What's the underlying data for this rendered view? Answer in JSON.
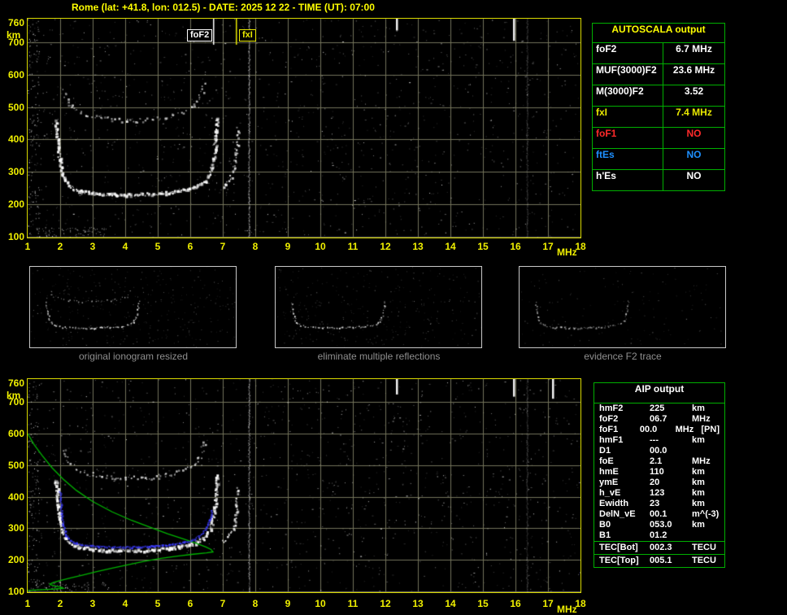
{
  "title": "Rome (lat: +41.8, lon: 012.5) - DATE: 2025 12 22 - TIME (UT): 07:00",
  "colors": {
    "accent_yellow": "#ffff00",
    "plot_border_yellow": "#d9d900",
    "grid_olive": "#73735a",
    "table_green": "#00b000",
    "trace_white": "#ffffff",
    "profile_green": "#00b400",
    "restored_blue": "#3c3cff",
    "caption_gray": "#8f8f8f"
  },
  "autoscala_table": {
    "header": "AUTOSCALA output",
    "rows": [
      {
        "label": "foF2",
        "value": "6.7 MHz",
        "color": "#ffffff"
      },
      {
        "label": "MUF(3000)F2",
        "value": "23.6 MHz",
        "color": "#ffffff"
      },
      {
        "label": "M(3000)F2",
        "value": "3.52",
        "color": "#ffffff"
      },
      {
        "label": "fxI",
        "value": "7.4 MHz",
        "color": "#e8e800"
      },
      {
        "label": "foF1",
        "value": "NO",
        "color": "#ff2a2a"
      },
      {
        "label": "ftEs",
        "value": "NO",
        "color": "#1e90ff"
      },
      {
        "label": "h'Es",
        "value": "NO",
        "color": "#ffffff"
      }
    ]
  },
  "thumbnails": [
    {
      "caption": "original ionogram resized"
    },
    {
      "caption": "eliminate multiple reflections"
    },
    {
      "caption": "evidence F2 trace"
    }
  ],
  "aip_table": {
    "header": "AIP output",
    "rows": [
      [
        "hmF2",
        "225",
        "km"
      ],
      [
        "foF2",
        "06.7",
        "MHz"
      ],
      [
        "foF1",
        "00.0",
        "MHz   [PN]"
      ],
      [
        "hmF1",
        "---",
        "km"
      ],
      [
        "D1",
        "00.0",
        ""
      ],
      [
        "foE",
        "2.1",
        "MHz"
      ],
      [
        "hmE",
        "110",
        "km"
      ],
      [
        "ymE",
        "20",
        "km"
      ],
      [
        "h_vE",
        "123",
        "km"
      ],
      [
        "Ewidth",
        "23",
        "km"
      ],
      [
        "DelN_vE",
        "00.1",
        "m^(-3)"
      ],
      [
        "B0",
        "053.0",
        "km"
      ],
      [
        "B1",
        "01.2",
        ""
      ],
      [
        "TEC[Bot]",
        "002.3",
        "TECU"
      ],
      [
        "TEC[Top]",
        "005.1",
        "TECU"
      ]
    ]
  },
  "chart_data": [
    {
      "type": "scatter",
      "name": "scaled ionogram (virtual height vs frequency)",
      "xlabel": "MHz",
      "ylabel": "km",
      "xlim": [
        1,
        18
      ],
      "ylim": [
        100,
        760
      ],
      "x_ticks": [
        1,
        2,
        3,
        4,
        5,
        6,
        7,
        8,
        9,
        10,
        11,
        12,
        13,
        14,
        15,
        16,
        17,
        18
      ],
      "y_ticks": [
        760,
        700,
        600,
        500,
        400,
        300,
        200,
        100
      ],
      "grid": true,
      "legend": false,
      "markers": [
        {
          "label": "foF2",
          "freq_mhz": 6.7,
          "color": "#ffffff"
        },
        {
          "label": "fxI",
          "freq_mhz": 7.4,
          "color": "#e8e800"
        }
      ],
      "rfi_lines_mhz": [
        7.8,
        16.35
      ],
      "top_ticks_mhz": [
        12.35,
        15.95
      ],
      "series": [
        {
          "name": "F2 trace 1st hop",
          "points": [
            [
              1.85,
              460
            ],
            [
              1.88,
              420
            ],
            [
              1.92,
              380
            ],
            [
              1.96,
              345
            ],
            [
              2.0,
              315
            ],
            [
              2.06,
              292
            ],
            [
              2.12,
              276
            ],
            [
              2.22,
              262
            ],
            [
              2.35,
              252
            ],
            [
              2.5,
              245
            ],
            [
              2.7,
              240
            ],
            [
              3.0,
              236
            ],
            [
              3.3,
              233
            ],
            [
              3.6,
              232
            ],
            [
              4.0,
              231
            ],
            [
              4.4,
              232
            ],
            [
              4.8,
              234
            ],
            [
              5.2,
              237
            ],
            [
              5.6,
              242
            ],
            [
              5.9,
              248
            ],
            [
              6.1,
              255
            ],
            [
              6.3,
              264
            ],
            [
              6.45,
              276
            ],
            [
              6.55,
              291
            ],
            [
              6.63,
              312
            ],
            [
              6.69,
              338
            ],
            [
              6.73,
              368
            ],
            [
              6.76,
              402
            ],
            [
              6.79,
              440
            ],
            [
              6.81,
              472
            ]
          ]
        },
        {
          "name": "X-mode cusp near fxI",
          "points": [
            [
              6.95,
              256
            ],
            [
              7.05,
              263
            ],
            [
              7.15,
              273
            ],
            [
              7.25,
              289
            ],
            [
              7.32,
              312
            ],
            [
              7.38,
              344
            ],
            [
              7.42,
              388
            ],
            [
              7.45,
              436
            ]
          ]
        },
        {
          "name": "F2 trace 2nd hop",
          "points": [
            [
              2.1,
              560
            ],
            [
              2.15,
              532
            ],
            [
              2.25,
              510
            ],
            [
              2.4,
              495
            ],
            [
              2.6,
              484
            ],
            [
              2.9,
              474
            ],
            [
              3.2,
              468
            ],
            [
              3.6,
              463
            ],
            [
              4.0,
              461
            ],
            [
              4.4,
              461
            ],
            [
              4.8,
              464
            ],
            [
              5.2,
              470
            ],
            [
              5.6,
              479
            ],
            [
              5.9,
              490
            ],
            [
              6.1,
              504
            ],
            [
              6.25,
              524
            ],
            [
              6.35,
              550
            ],
            [
              6.42,
              582
            ]
          ]
        }
      ]
    },
    {
      "type": "scatter",
      "name": "ionogram with autoscaled trace and electron density profile",
      "xlabel": "MHz",
      "ylabel": "km",
      "xlim": [
        1,
        18
      ],
      "ylim": [
        100,
        760
      ],
      "x_ticks": [
        1,
        2,
        3,
        4,
        5,
        6,
        7,
        8,
        9,
        10,
        11,
        12,
        13,
        14,
        15,
        16,
        17,
        18
      ],
      "y_ticks": [
        760,
        700,
        600,
        500,
        400,
        300,
        200,
        100
      ],
      "grid": true,
      "legend": false,
      "rfi_lines_mhz": [
        7.8,
        16.35
      ],
      "top_ticks_mhz": [
        12.35,
        15.95,
        17.15
      ],
      "series": [
        {
          "name": "F2 trace 1st hop",
          "points": [
            [
              1.85,
              460
            ],
            [
              1.88,
              420
            ],
            [
              1.92,
              380
            ],
            [
              1.96,
              345
            ],
            [
              2.0,
              315
            ],
            [
              2.06,
              292
            ],
            [
              2.12,
              276
            ],
            [
              2.22,
              262
            ],
            [
              2.35,
              252
            ],
            [
              2.5,
              245
            ],
            [
              2.7,
              240
            ],
            [
              3.0,
              236
            ],
            [
              3.3,
              233
            ],
            [
              3.6,
              232
            ],
            [
              4.0,
              231
            ],
            [
              4.4,
              232
            ],
            [
              4.8,
              234
            ],
            [
              5.2,
              237
            ],
            [
              5.6,
              242
            ],
            [
              5.9,
              248
            ],
            [
              6.1,
              255
            ],
            [
              6.3,
              264
            ],
            [
              6.45,
              276
            ],
            [
              6.55,
              291
            ],
            [
              6.63,
              312
            ],
            [
              6.69,
              338
            ],
            [
              6.73,
              368
            ],
            [
              6.76,
              402
            ],
            [
              6.79,
              440
            ],
            [
              6.81,
              472
            ]
          ]
        },
        {
          "name": "X-mode cusp near fxI",
          "points": [
            [
              6.95,
              256
            ],
            [
              7.05,
              263
            ],
            [
              7.15,
              273
            ],
            [
              7.25,
              289
            ],
            [
              7.32,
              312
            ],
            [
              7.38,
              344
            ],
            [
              7.42,
              388
            ],
            [
              7.45,
              436
            ]
          ]
        },
        {
          "name": "F2 trace 2nd hop",
          "points": [
            [
              2.1,
              560
            ],
            [
              2.15,
              532
            ],
            [
              2.25,
              510
            ],
            [
              2.4,
              495
            ],
            [
              2.6,
              484
            ],
            [
              2.9,
              474
            ],
            [
              3.2,
              468
            ],
            [
              3.6,
              463
            ],
            [
              4.0,
              461
            ],
            [
              4.4,
              461
            ],
            [
              4.8,
              464
            ],
            [
              5.2,
              470
            ],
            [
              5.6,
              479
            ],
            [
              5.9,
              490
            ],
            [
              6.1,
              504
            ],
            [
              6.25,
              524
            ],
            [
              6.35,
              550
            ],
            [
              6.42,
              582
            ]
          ]
        }
      ],
      "profile": {
        "name": "electron density profile (plasma frequency vs true height)",
        "color": "#00b400",
        "points": [
          [
            0.6,
            100
          ],
          [
            1.2,
            104
          ],
          [
            1.7,
            107
          ],
          [
            2.0,
            109
          ],
          [
            2.1,
            110
          ],
          [
            2.02,
            113
          ],
          [
            1.86,
            117
          ],
          [
            1.73,
            120
          ],
          [
            1.68,
            123
          ],
          [
            1.78,
            128
          ],
          [
            1.98,
            134
          ],
          [
            2.3,
            142
          ],
          [
            2.7,
            152
          ],
          [
            3.1,
            162
          ],
          [
            3.6,
            174
          ],
          [
            4.1,
            185
          ],
          [
            4.6,
            196
          ],
          [
            5.1,
            205
          ],
          [
            5.6,
            212
          ],
          [
            6.1,
            218
          ],
          [
            6.5,
            222
          ],
          [
            6.7,
            225
          ],
          [
            6.64,
            233
          ],
          [
            6.48,
            241
          ],
          [
            6.2,
            252
          ],
          [
            5.8,
            266
          ],
          [
            5.3,
            283
          ],
          [
            4.8,
            302
          ],
          [
            4.2,
            325
          ],
          [
            3.6,
            352
          ],
          [
            3.0,
            385
          ],
          [
            2.5,
            420
          ],
          [
            2.1,
            455
          ],
          [
            1.75,
            492
          ],
          [
            1.45,
            530
          ],
          [
            1.2,
            565
          ],
          [
            1.0,
            600
          ]
        ]
      },
      "restored_trace": {
        "name": "autoscaled F2 trace",
        "color": "#3c3cff",
        "points": [
          [
            1.98,
            420
          ],
          [
            2.0,
            392
          ],
          [
            2.02,
            362
          ],
          [
            2.05,
            332
          ],
          [
            2.1,
            302
          ],
          [
            2.16,
            282
          ],
          [
            2.26,
            266
          ],
          [
            2.4,
            256
          ],
          [
            2.6,
            250
          ],
          [
            2.9,
            246
          ],
          [
            3.3,
            243
          ],
          [
            3.7,
            242
          ],
          [
            4.1,
            242
          ],
          [
            4.5,
            243
          ],
          [
            4.9,
            245
          ],
          [
            5.3,
            249
          ],
          [
            5.7,
            255
          ],
          [
            6.0,
            262
          ],
          [
            6.2,
            272
          ],
          [
            6.35,
            285
          ],
          [
            6.5,
            305
          ],
          [
            6.6,
            330
          ],
          [
            6.66,
            362
          ]
        ]
      }
    }
  ]
}
